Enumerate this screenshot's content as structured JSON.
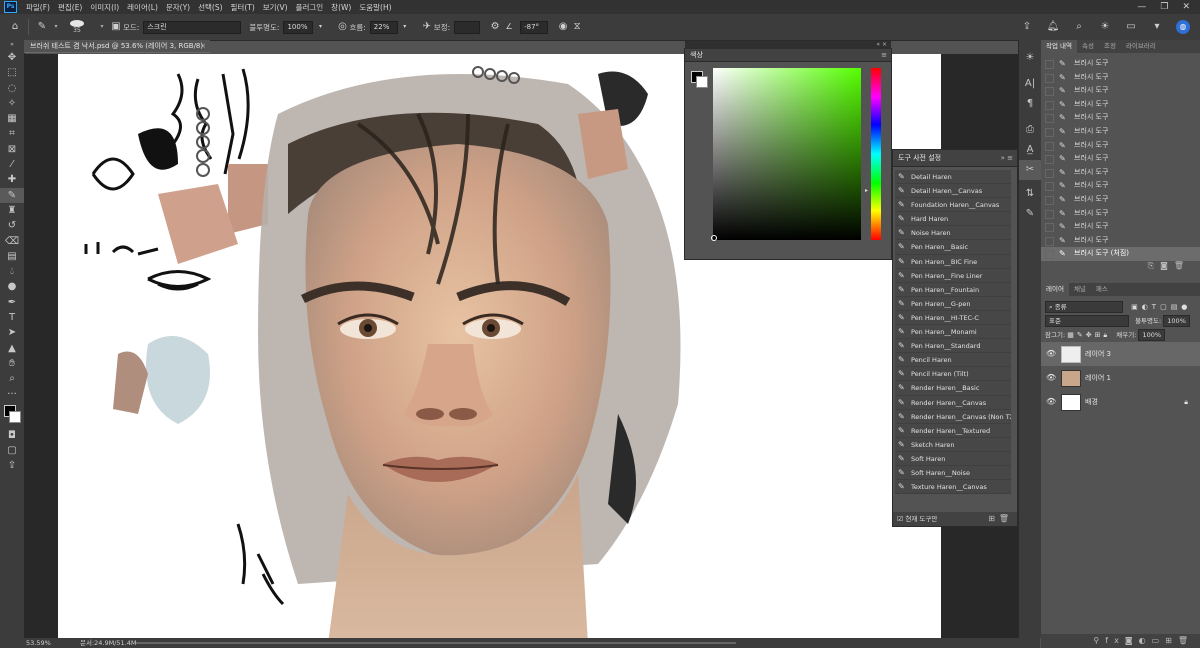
{
  "menu": {
    "logo": "Ps",
    "items": [
      "파일(F)",
      "편집(E)",
      "이미지(I)",
      "레이어(L)",
      "문자(Y)",
      "선택(S)",
      "필터(T)",
      "보기(V)",
      "플러그인",
      "창(W)",
      "도움말(H)"
    ],
    "window_buttons": [
      "—",
      "❐",
      "✕"
    ]
  },
  "options": {
    "brush_size": "35",
    "mode_label": "모드:",
    "mode_value": "스크린",
    "opacity_label": "불투명도:",
    "opacity_value": "100%",
    "flow_label": "흐름:",
    "flow_value": "22%",
    "smoothing_label": "보정:",
    "smoothing_value": "",
    "angle_value": "-87°"
  },
  "document": {
    "tab_title": "브러쉬 테스트 겸 낙서.psd @ 53.6% (레이어 3, RGB/8)",
    "close": "×",
    "zoom": "53.59%",
    "file_info": "문서:24.9M/51.4M"
  },
  "color_panel": {
    "title": "색상",
    "header_controls": "« ×"
  },
  "presets_panel": {
    "title": "도구 사전 설정",
    "items": [
      "Detail  Haren",
      "Detail  Haren__Canvas",
      "Foundation  Haren__Canvas",
      "Hard  Haren",
      "Noise Haren",
      "Pen  Haren__Basic",
      "Pen  Haren__BIC Fine",
      "Pen  Haren__Fine Liner",
      "Pen  Haren__Fountain",
      "Pen  Haren__G-pen",
      "Pen  Haren__HI-TEC-C",
      "Pen  Haren__Monami",
      "Pen  Haren__Standard",
      "Pencil  Haren",
      "Pencil  Haren (Tilt)",
      "Render  Haren__Basic",
      "Render  Haren__Canvas",
      "Render  Haren__Canvas (Non TX)",
      "Render  Haren__Textured",
      "Sketch  Haren",
      "Soft  Haren",
      "Soft  Haren__Noise",
      "Texture  Haren__Canvas"
    ],
    "footer_label": "현재 도구만"
  },
  "history_panel": {
    "tabs": [
      "작업 내역",
      "속성",
      "조정",
      "라이브러리"
    ],
    "items": [
      "브러시 도구",
      "브러시 도구",
      "브러시 도구",
      "브러시 도구",
      "브러시 도구",
      "브러시 도구",
      "브러시 도구",
      "브러시 도구",
      "브러시 도구",
      "브러시 도구",
      "브러시 도구",
      "브러시 도구",
      "브러시 도구",
      "브러시 도구",
      "브러시 도구 (처짐)"
    ]
  },
  "layers_panel": {
    "tabs": [
      "레이어",
      "채널",
      "패스"
    ],
    "filter_label": "종류",
    "blend_mode": "표준",
    "opacity_label": "불투명도:",
    "opacity_value": "100%",
    "lock_label": "잠그기:",
    "fill_label": "채우기:",
    "fill_value": "100%",
    "layers": [
      {
        "name": "레이어 3",
        "selected": true
      },
      {
        "name": "레이어 1",
        "selected": false
      },
      {
        "name": "배경",
        "selected": false
      }
    ]
  }
}
